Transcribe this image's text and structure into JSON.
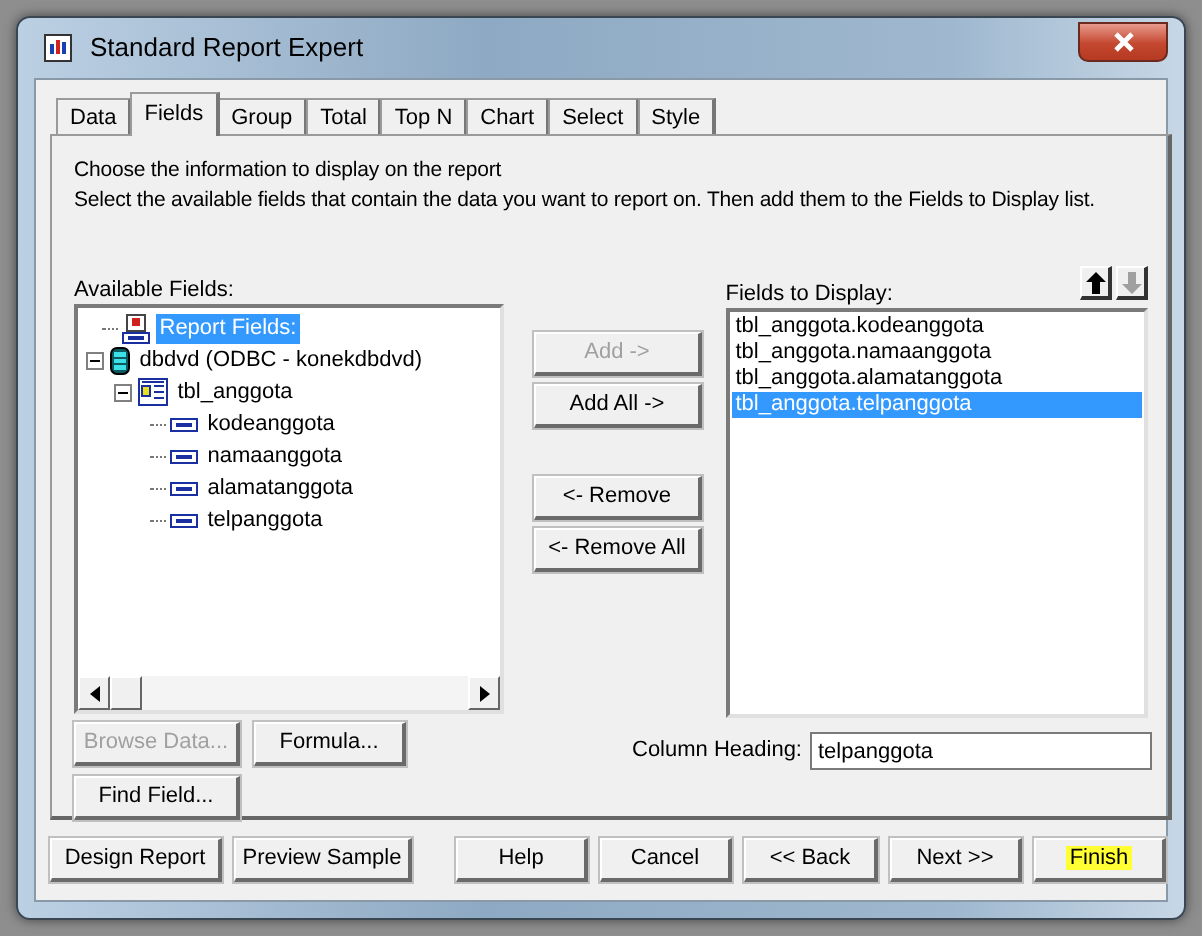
{
  "window": {
    "title": "Standard Report Expert"
  },
  "tabs": [
    {
      "label": "Data",
      "selected": false
    },
    {
      "label": "Fields",
      "selected": true
    },
    {
      "label": "Group",
      "selected": false
    },
    {
      "label": "Total",
      "selected": false
    },
    {
      "label": "Top N",
      "selected": false
    },
    {
      "label": "Chart",
      "selected": false
    },
    {
      "label": "Select",
      "selected": false
    },
    {
      "label": "Style",
      "selected": false
    }
  ],
  "instructions": [
    "Choose the information to display on the report",
    "Select the available fields that contain the data you want to report on.  Then add them to the Fields to Display list."
  ],
  "available_fields": {
    "label": "Available Fields:",
    "tree": [
      {
        "label": "Report Fields:",
        "kind": "report",
        "selected": true
      },
      {
        "label": "dbdvd (ODBC - konekdbdvd)",
        "kind": "database",
        "selected": false,
        "expanded": true,
        "children": [
          {
            "label": "tbl_anggota",
            "kind": "table",
            "selected": false,
            "expanded": true,
            "children": [
              {
                "label": "kodeanggota",
                "kind": "field",
                "selected": false
              },
              {
                "label": "namaanggota",
                "kind": "field",
                "selected": false
              },
              {
                "label": "alamatanggota",
                "kind": "field",
                "selected": false
              },
              {
                "label": "telpanggota",
                "kind": "field",
                "selected": false
              }
            ]
          }
        ]
      }
    ]
  },
  "move_buttons": [
    {
      "label": "Add ->",
      "disabled": true
    },
    {
      "label": "Add All ->",
      "disabled": false
    },
    {
      "label": "<- Remove",
      "disabled": false
    },
    {
      "label": "<- Remove All",
      "disabled": false
    }
  ],
  "fields_to_display": {
    "label": "Fields to Display:",
    "items": [
      {
        "label": "tbl_anggota.kodeanggota",
        "selected": false
      },
      {
        "label": "tbl_anggota.namaanggota",
        "selected": false
      },
      {
        "label": "tbl_anggota.alamatanggota",
        "selected": false
      },
      {
        "label": "tbl_anggota.telpanggota",
        "selected": true
      }
    ],
    "move_up_disabled": false,
    "move_down_disabled": true
  },
  "field_buttons": [
    {
      "label": "Browse Data...",
      "disabled": true
    },
    {
      "label": "Formula...",
      "disabled": false
    },
    {
      "label": "Find Field...",
      "disabled": false
    }
  ],
  "column_heading": {
    "label": "Column Heading:",
    "value": "telpanggota"
  },
  "footer_buttons": [
    {
      "label": "Design Report",
      "highlighted": false
    },
    {
      "label": "Preview Sample",
      "highlighted": false
    },
    {
      "label": "Help",
      "highlighted": false
    },
    {
      "label": "Cancel",
      "highlighted": false
    },
    {
      "label": "<< Back",
      "highlighted": false
    },
    {
      "label": "Next >>",
      "highlighted": false
    },
    {
      "label": "Finish",
      "highlighted": true
    }
  ]
}
